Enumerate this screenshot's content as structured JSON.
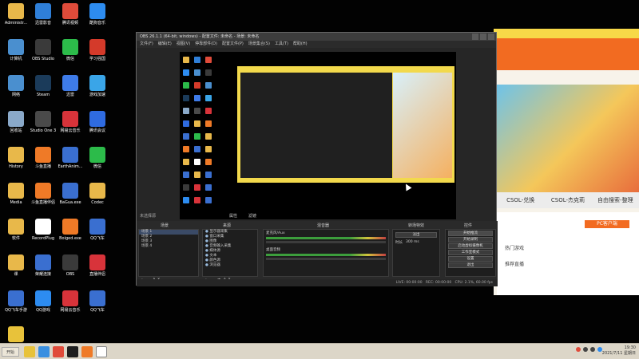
{
  "desktop": {
    "icons": [
      {
        "label": "Administr...",
        "color": "#e8b84a"
      },
      {
        "label": "迅雷影音",
        "color": "#2f7fd8"
      },
      {
        "label": "腾讯视频",
        "color": "#e04b3a"
      },
      {
        "label": "酷狗音乐",
        "color": "#2d8cf0"
      },
      {
        "label": "计算机",
        "color": "#4a8fcf"
      },
      {
        "label": "OBS Studio",
        "color": "#3a3a3a"
      },
      {
        "label": "微信",
        "color": "#2cbb4a"
      },
      {
        "label": "学习强国",
        "color": "#d43a2a"
      },
      {
        "label": "网络",
        "color": "#4a8fcf"
      },
      {
        "label": "Steam",
        "color": "#1b3b5a"
      },
      {
        "label": "迅雷",
        "color": "#3e7be8"
      },
      {
        "label": "游戏加速",
        "color": "#3aa5e8"
      },
      {
        "label": "回收站",
        "color": "#8aa9c9"
      },
      {
        "label": "Studio One 3",
        "color": "#4a4a4a"
      },
      {
        "label": "网易云音乐",
        "color": "#d8333a"
      },
      {
        "label": "腾讯会议",
        "color": "#2f6be0"
      },
      {
        "label": "History",
        "color": "#e8b84a"
      },
      {
        "label": "斗鱼直播",
        "color": "#ef7a27"
      },
      {
        "label": "EarthAnim...",
        "color": "#3a6fd0"
      },
      {
        "label": "微信",
        "color": "#2cbb4a"
      },
      {
        "label": "Media",
        "color": "#e8b84a"
      },
      {
        "label": "斗鱼直播伴侣",
        "color": "#ef7a27"
      },
      {
        "label": "BaGua.exe",
        "color": "#3a6fd0"
      },
      {
        "label": "Codec",
        "color": "#e8b84a"
      },
      {
        "label": "软件",
        "color": "#e8b84a"
      },
      {
        "label": "RecordPlug",
        "color": "#ffffff"
      },
      {
        "label": "Boiged.exe",
        "color": "#ef7a27"
      },
      {
        "label": "QQ飞车",
        "color": "#3a6fd0"
      },
      {
        "label": "课",
        "color": "#e8b84a"
      },
      {
        "label": "荣耀连接",
        "color": "#3a6fd0"
      },
      {
        "label": "OBS",
        "color": "#3a3a3a"
      },
      {
        "label": "直播伴侣",
        "color": "#d8333a"
      },
      {
        "label": "QQ飞车手游",
        "color": "#3a6fd0"
      },
      {
        "label": "QQ游戏",
        "color": "#2d8cf0"
      },
      {
        "label": "网易云音乐",
        "color": "#d8333a"
      },
      {
        "label": "QQ飞车",
        "color": "#3a6fd0"
      },
      {
        "label": "YY语音",
        "color": "#e8c23a"
      }
    ]
  },
  "obs": {
    "title": "OBS 26.1.1 (64-bit, windows) - 配置文件: 未命名 - 场景: 未命名",
    "menu": [
      "文件(F)",
      "编辑(E)",
      "视图(V)",
      "停靠部件(D)",
      "配置文件(P)",
      "场景集合(S)",
      "工具(T)",
      "帮助(H)"
    ],
    "scene_toolbar": {
      "no_source": "未选择源",
      "properties": "属性",
      "filters": "滤镜"
    },
    "panels": {
      "scenes": "场景",
      "sources": "来源",
      "mixer": "混音器",
      "transitions": "转场特效",
      "controls": "控件"
    },
    "scenes_list": [
      "场景 1",
      "场景 2",
      "场景 3",
      "场景 4"
    ],
    "sources_list": [
      "显示器采集",
      "窗口采集",
      "图像",
      "音频输入采集",
      "媒体源",
      "文本",
      "颜色源",
      "浏览器"
    ],
    "mixer_tracks": [
      {
        "name": "麦克风/Aux",
        "db": "0.0 dB"
      },
      {
        "name": "桌面音频",
        "db": "0.0 dB"
      }
    ],
    "transition": {
      "type": "淡出",
      "duration_label": "时长",
      "duration": "300 ms"
    },
    "controls": [
      "开始推流",
      "开始录制",
      "启动虚拟摄像机",
      "工作室模式",
      "设置",
      "退出"
    ],
    "status": {
      "live": "LIVE: 00:00:00",
      "rec": "REC: 00:00:00",
      "cpu": "CPU: 2.1%, 60.00 fps"
    }
  },
  "browser": {
    "tabs": [
      "CSOL-兑换",
      "CSOL-杰克莉",
      "自由搜索-整理"
    ],
    "button": "PC客户端",
    "rows": [
      "热门游戏",
      "推荐直播"
    ]
  },
  "taskbar": {
    "start": "开始",
    "icons": [
      {
        "name": "file-explorer-icon",
        "color": "#e8c23a"
      },
      {
        "name": "ie-browser-icon",
        "color": "#3a8fe0"
      },
      {
        "name": "media-player-icon",
        "color": "#e04b3a"
      },
      {
        "name": "obs-icon",
        "color": "#1e1e1e"
      },
      {
        "name": "douyu-icon",
        "color": "#ef7a27"
      },
      {
        "name": "recorder-icon",
        "color": "#ffffff"
      }
    ],
    "time": "19:30",
    "date": "2021/7/11 星期日"
  }
}
